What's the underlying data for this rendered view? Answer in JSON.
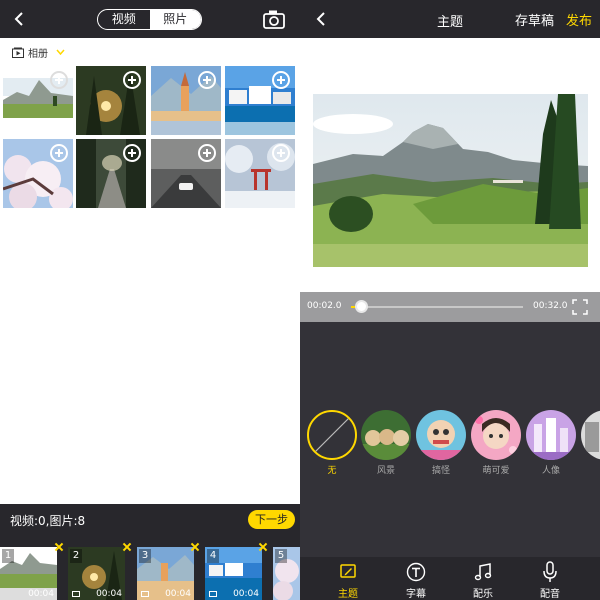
{
  "left": {
    "segment": {
      "video": "视频",
      "photo": "照片"
    },
    "album_label": "相册",
    "thumbnails": [
      {
        "id": 1
      },
      {
        "id": 2
      },
      {
        "id": 3
      },
      {
        "id": 4
      },
      {
        "id": 5
      },
      {
        "id": 6
      },
      {
        "id": 7
      },
      {
        "id": 8
      }
    ],
    "bottom": {
      "count_text": "视频:0,图片:8",
      "next_label": "下一步",
      "selected": [
        {
          "index": "1",
          "duration": "00:04"
        },
        {
          "index": "2",
          "duration": "00:04"
        },
        {
          "index": "3",
          "duration": "00:04"
        },
        {
          "index": "4",
          "duration": "00:04"
        },
        {
          "index": "5",
          "duration": ""
        }
      ]
    }
  },
  "right": {
    "title": "主题",
    "draft_label": "存草稿",
    "publish_label": "发布",
    "timeline": {
      "start": "00:02.0",
      "end": "00:32.0",
      "progress": 0.06
    },
    "themes": [
      {
        "name": "无",
        "active": true
      },
      {
        "name": "风景",
        "active": false
      },
      {
        "name": "搞怪",
        "active": false
      },
      {
        "name": "萌可爱",
        "active": false
      },
      {
        "name": "人像",
        "active": false
      },
      {
        "name": "",
        "active": false
      }
    ],
    "tabs": [
      {
        "label": "主题",
        "icon": "theme-icon",
        "active": true
      },
      {
        "label": "字幕",
        "icon": "subtitle-icon",
        "active": false
      },
      {
        "label": "配乐",
        "icon": "music-icon",
        "active": false
      },
      {
        "label": "配音",
        "icon": "microphone-icon",
        "active": false
      }
    ]
  },
  "colors": {
    "accent": "#ffd800",
    "bar": "#28272c",
    "panel": "#333238"
  }
}
